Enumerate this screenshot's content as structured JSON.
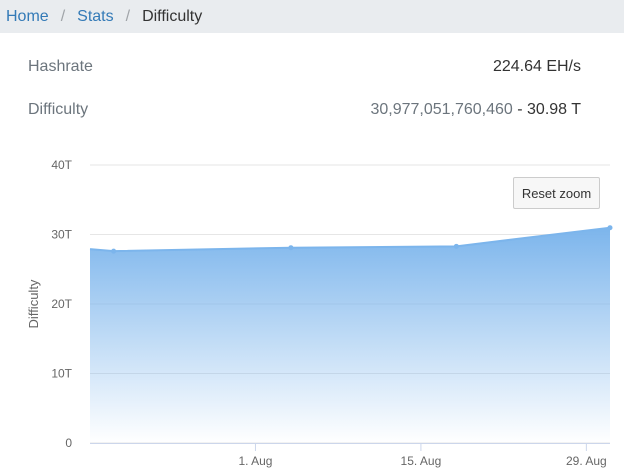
{
  "breadcrumb": {
    "items": [
      "Home",
      "Stats"
    ],
    "current": "Difficulty"
  },
  "stats": {
    "hashrate": {
      "label": "Hashrate",
      "value": "224.64 EH/s"
    },
    "difficulty": {
      "label": "Difficulty",
      "value": "30,977,051,760,460",
      "short": " - 30.98 T"
    }
  },
  "reset_zoom_label": "Reset zoom",
  "colors": {
    "link": "#337ab7",
    "series_fill": "#7cb5ec",
    "grid": "#e6e6e6"
  },
  "chart_data": {
    "type": "area",
    "ylabel": "Difficulty",
    "ylim": [
      0,
      40
    ],
    "y_ticks": [
      0,
      10,
      20,
      30,
      40
    ],
    "y_tick_labels": [
      "0",
      "10T",
      "20T",
      "30T",
      "40T"
    ],
    "xlim": [
      "2023-07-18",
      "2023-08-31"
    ],
    "x_ticks": [
      "2023-08-01",
      "2023-08-15",
      "2023-08-29"
    ],
    "x_tick_labels": [
      "1. Aug",
      "15. Aug",
      "29. Aug"
    ],
    "series": [
      {
        "x": [
          "2023-07-18",
          "2023-07-20",
          "2023-08-04",
          "2023-08-18",
          "2023-08-31"
        ],
        "values": [
          27.9,
          27.6,
          28.1,
          28.3,
          30.98
        ]
      }
    ]
  }
}
